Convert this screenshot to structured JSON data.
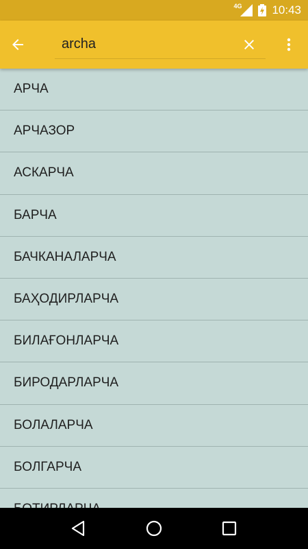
{
  "status_bar": {
    "network": "4G",
    "time": "10:43"
  },
  "app_bar": {
    "search_value": "archa",
    "back_icon": "arrow-back-icon",
    "clear_icon": "close-icon",
    "menu_icon": "more-vert-icon"
  },
  "results": [
    "АРЧА",
    "АРЧАЗОР",
    "АСКАРЧА",
    "БАРЧА",
    "БАЧКАНАЛАРЧА",
    "БАҲОДИРЛАРЧА",
    "БИЛАҒОНЛАРЧА",
    "БИРОДАРЛАРЧА",
    "БОЛАЛАРЧА",
    "БОЛГАРЧА",
    "БОТИРЛАРЧА"
  ],
  "colors": {
    "status_bar": "#d8a920",
    "app_bar": "#f0c02c",
    "list_bg": "#c5d9d6",
    "nav_bar": "#000000"
  }
}
